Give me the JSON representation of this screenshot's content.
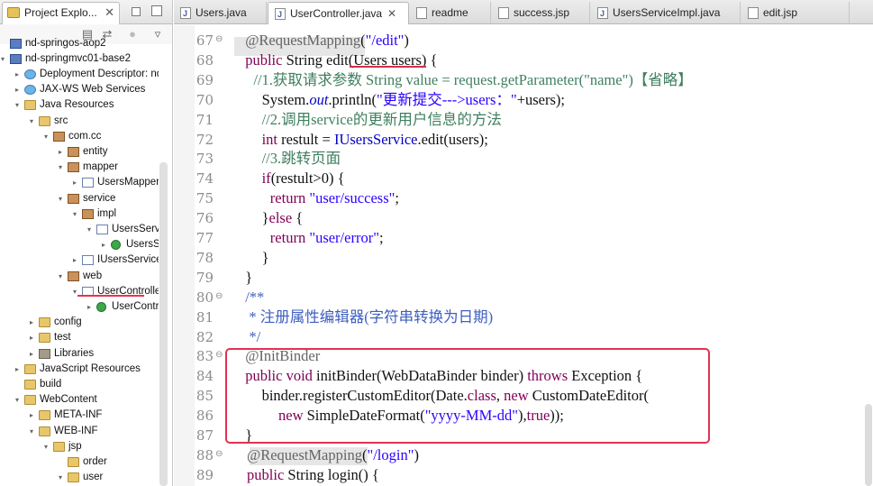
{
  "explorer": {
    "tab_title": "Project Explo...",
    "tab_close": "✕",
    "items": [
      {
        "label": "nd-springos-aop2",
        "indent": 0,
        "icon": "project",
        "twisty": ""
      },
      {
        "label": "nd-springmvc01-base2",
        "indent": 0,
        "icon": "project",
        "twisty": "▾"
      },
      {
        "label": "Deployment Descriptor: nd-",
        "indent": 1,
        "icon": "web",
        "twisty": "▸"
      },
      {
        "label": "JAX-WS Web Services",
        "indent": 1,
        "icon": "web",
        "twisty": "▸"
      },
      {
        "label": "Java Resources",
        "indent": 1,
        "icon": "folder",
        "twisty": "▾"
      },
      {
        "label": "src",
        "indent": 2,
        "icon": "folder",
        "twisty": "▾"
      },
      {
        "label": "com.cc",
        "indent": 3,
        "icon": "package",
        "twisty": "▾"
      },
      {
        "label": "entity",
        "indent": 4,
        "icon": "package",
        "twisty": "▸"
      },
      {
        "label": "mapper",
        "indent": 4,
        "icon": "package",
        "twisty": "▾"
      },
      {
        "label": "UsersMapper.ja",
        "indent": 5,
        "icon": "java",
        "twisty": "▸"
      },
      {
        "label": "service",
        "indent": 4,
        "icon": "package",
        "twisty": "▾"
      },
      {
        "label": "impl",
        "indent": 5,
        "icon": "package",
        "twisty": "▾"
      },
      {
        "label": "UsersService",
        "indent": 6,
        "icon": "java",
        "twisty": "▾"
      },
      {
        "label": "UsersSer",
        "indent": 7,
        "icon": "class",
        "twisty": "▸"
      },
      {
        "label": "IUsersService.ja",
        "indent": 5,
        "icon": "java",
        "twisty": "▸"
      },
      {
        "label": "web",
        "indent": 4,
        "icon": "package",
        "twisty": "▾"
      },
      {
        "label": "UserController.j",
        "indent": 5,
        "icon": "java",
        "twisty": "▾"
      },
      {
        "label": "UserControll",
        "indent": 6,
        "icon": "class",
        "twisty": "▸"
      },
      {
        "label": "config",
        "indent": 2,
        "icon": "folder",
        "twisty": "▸"
      },
      {
        "label": "test",
        "indent": 2,
        "icon": "folder",
        "twisty": "▸"
      },
      {
        "label": "Libraries",
        "indent": 2,
        "icon": "lib",
        "twisty": "▸"
      },
      {
        "label": "JavaScript Resources",
        "indent": 1,
        "icon": "folder",
        "twisty": "▸"
      },
      {
        "label": "build",
        "indent": 1,
        "icon": "folder",
        "twisty": ""
      },
      {
        "label": "WebContent",
        "indent": 1,
        "icon": "folder",
        "twisty": "▾"
      },
      {
        "label": "META-INF",
        "indent": 2,
        "icon": "folder",
        "twisty": "▸"
      },
      {
        "label": "WEB-INF",
        "indent": 2,
        "icon": "folder",
        "twisty": "▾"
      },
      {
        "label": "jsp",
        "indent": 3,
        "icon": "folder",
        "twisty": "▾"
      },
      {
        "label": "order",
        "indent": 4,
        "icon": "folder",
        "twisty": ""
      },
      {
        "label": "user",
        "indent": 4,
        "icon": "folder",
        "twisty": "▾"
      }
    ]
  },
  "editor_tabs": [
    {
      "label": "Users.java",
      "icon": "java",
      "active": false
    },
    {
      "label": "UserController.java",
      "icon": "java",
      "active": true
    },
    {
      "label": "readme",
      "icon": "file",
      "active": false
    },
    {
      "label": "success.jsp",
      "icon": "file",
      "active": false
    },
    {
      "label": "UsersServiceImpl.java",
      "icon": "java",
      "active": false
    },
    {
      "label": "edit.jsp",
      "icon": "file",
      "active": false
    }
  ],
  "editor_tab_close": "✕",
  "code": {
    "lines": [
      {
        "num": "67",
        "fold": "⊖",
        "indent": 1,
        "tokens": [
          {
            "t": "@RequestMapping",
            "c": "ann"
          },
          {
            "t": "(",
            "c": ""
          },
          {
            "t": "\"/edit\"",
            "c": "str"
          },
          {
            "t": ")",
            "c": ""
          }
        ]
      },
      {
        "num": "68",
        "fold": "",
        "indent": 1,
        "tokens": [
          {
            "t": "public",
            "c": "kw"
          },
          {
            "t": " String edit(Users ",
            "c": ""
          },
          {
            "t": "users",
            "c": ""
          },
          {
            "t": ") {",
            "c": ""
          }
        ]
      },
      {
        "num": "69",
        "fold": "",
        "indent": 2,
        "tokens": [
          {
            "t": "//1.获取请求参数 String value = request.getParameter(\"name\")【省略】",
            "c": "cmt"
          }
        ]
      },
      {
        "num": "70",
        "fold": "",
        "indent": 3,
        "tokens": [
          {
            "t": "System.",
            "c": ""
          },
          {
            "t": "out",
            "c": "fld it"
          },
          {
            "t": ".println(",
            "c": ""
          },
          {
            "t": "\"更新提交--->users：\"",
            "c": "str"
          },
          {
            "t": "+users);",
            "c": ""
          }
        ]
      },
      {
        "num": "71",
        "fold": "",
        "indent": 3,
        "tokens": [
          {
            "t": "//2.调用service的更新用户信息的方法",
            "c": "cmt"
          }
        ]
      },
      {
        "num": "72",
        "fold": "",
        "indent": 3,
        "tokens": [
          {
            "t": "int",
            "c": "kw"
          },
          {
            "t": " restult = ",
            "c": ""
          },
          {
            "t": "IUsersService",
            "c": "fld"
          },
          {
            "t": ".edit(users);",
            "c": ""
          }
        ]
      },
      {
        "num": "73",
        "fold": "",
        "indent": 3,
        "tokens": [
          {
            "t": "//3.跳转页面",
            "c": "cmt"
          }
        ]
      },
      {
        "num": "74",
        "fold": "",
        "indent": 3,
        "tokens": [
          {
            "t": "if",
            "c": "kw"
          },
          {
            "t": "(restult>0) {",
            "c": ""
          }
        ]
      },
      {
        "num": "75",
        "fold": "",
        "indent": 4,
        "tokens": [
          {
            "t": "return",
            "c": "kw"
          },
          {
            "t": " ",
            "c": ""
          },
          {
            "t": "\"user/success\"",
            "c": "str"
          },
          {
            "t": ";",
            "c": ""
          }
        ]
      },
      {
        "num": "76",
        "fold": "",
        "indent": 3,
        "tokens": [
          {
            "t": "}",
            "c": ""
          },
          {
            "t": "else",
            "c": "kw"
          },
          {
            "t": " {",
            "c": ""
          }
        ]
      },
      {
        "num": "77",
        "fold": "",
        "indent": 4,
        "tokens": [
          {
            "t": "return",
            "c": "kw"
          },
          {
            "t": " ",
            "c": ""
          },
          {
            "t": "\"user/error\"",
            "c": "str"
          },
          {
            "t": ";",
            "c": ""
          }
        ]
      },
      {
        "num": "78",
        "fold": "",
        "indent": 3,
        "tokens": [
          {
            "t": "}",
            "c": ""
          }
        ]
      },
      {
        "num": "79",
        "fold": "",
        "indent": 1,
        "tokens": [
          {
            "t": "}",
            "c": ""
          }
        ]
      },
      {
        "num": "80",
        "fold": "⊖",
        "indent": 1,
        "tokens": [
          {
            "t": "/**",
            "c": "jdoc"
          }
        ]
      },
      {
        "num": "81",
        "fold": "",
        "indent": 1,
        "tokens": [
          {
            "t": " * 注册属性编辑器(字符串转换为日期)",
            "c": "jdoc"
          }
        ]
      },
      {
        "num": "82",
        "fold": "",
        "indent": 1,
        "tokens": [
          {
            "t": " */",
            "c": "jdoc"
          }
        ]
      },
      {
        "num": "83",
        "fold": "⊖",
        "indent": 1,
        "tokens": [
          {
            "t": "@InitBinder",
            "c": "ann"
          }
        ]
      },
      {
        "num": "84",
        "fold": "",
        "indent": 1,
        "tokens": [
          {
            "t": "public",
            "c": "kw"
          },
          {
            "t": " ",
            "c": ""
          },
          {
            "t": "void",
            "c": "kw"
          },
          {
            "t": " initBinder(WebDataBinder binder) ",
            "c": ""
          },
          {
            "t": "throws",
            "c": "kw"
          },
          {
            "t": " Exception {",
            "c": ""
          }
        ]
      },
      {
        "num": "85",
        "fold": "",
        "indent": 3,
        "tokens": [
          {
            "t": "binder.registerCustomEditor(Date.",
            "c": ""
          },
          {
            "t": "class",
            "c": "kw"
          },
          {
            "t": ", ",
            "c": ""
          },
          {
            "t": "new",
            "c": "kw"
          },
          {
            "t": " CustomDateEditor(",
            "c": ""
          }
        ]
      },
      {
        "num": "86",
        "fold": "",
        "indent": 5,
        "tokens": [
          {
            "t": "new",
            "c": "kw"
          },
          {
            "t": " SimpleDateFormat(",
            "c": ""
          },
          {
            "t": "\"yyyy-MM-dd\"",
            "c": "str"
          },
          {
            "t": "),",
            "c": ""
          },
          {
            "t": "true",
            "c": "kw"
          },
          {
            "t": "));",
            "c": ""
          }
        ]
      },
      {
        "num": "87",
        "fold": "",
        "indent": 1,
        "tokens": [
          {
            "t": "}",
            "c": ""
          }
        ]
      },
      {
        "num": "88",
        "fold": "⊖",
        "indent": 1.2,
        "tokens": [
          {
            "t": "@RequestMapping",
            "c": "ann"
          },
          {
            "t": "(",
            "c": ""
          },
          {
            "t": "\"/login\"",
            "c": "str"
          },
          {
            "t": ")",
            "c": ""
          }
        ]
      },
      {
        "num": "89",
        "fold": "",
        "indent": 1.2,
        "tokens": [
          {
            "t": "public",
            "c": "kw"
          },
          {
            "t": " String login() {",
            "c": ""
          }
        ]
      }
    ]
  }
}
